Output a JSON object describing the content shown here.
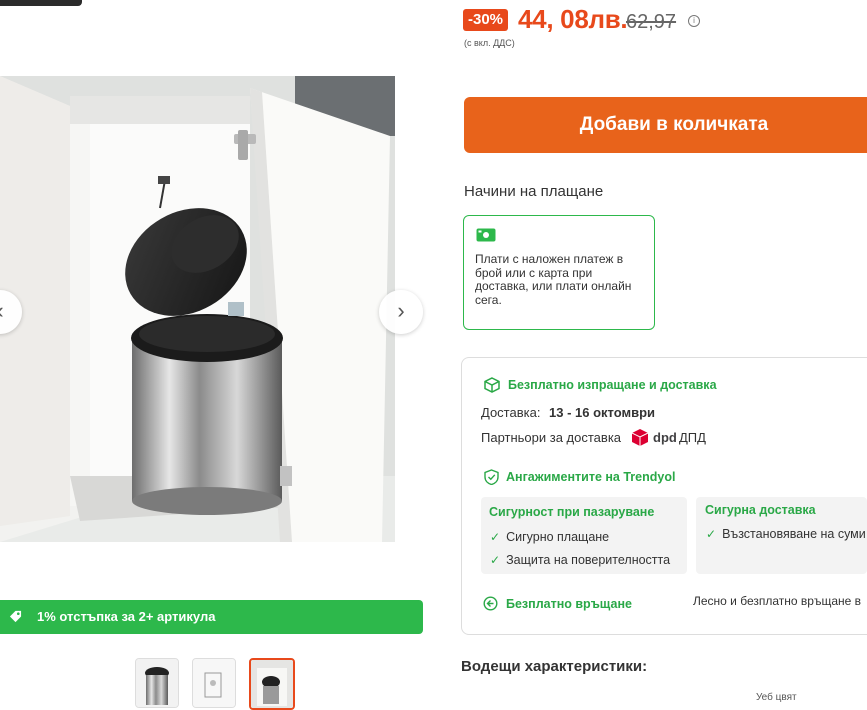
{
  "price": {
    "discount": "-30%",
    "current": "44, 08лв.",
    "old": "62,97",
    "info_icon": "info-icon",
    "vat_note": "(с вкл. ДДС)"
  },
  "gallery": {
    "prev_icon": "chevron-left-icon",
    "next_icon": "chevron-right-icon",
    "thumbnail_count": 3
  },
  "promo": {
    "icon": "tag-icon",
    "text": "1% отстъпка за 2+ артикула",
    "color": "#2db84b"
  },
  "cart": {
    "add_label": "Добави в количката",
    "color": "#e8631b"
  },
  "payment": {
    "heading": "Начини на плащане",
    "icon": "money-icon",
    "description": "Плати с наложен платеж в брой или с карта при доставка, или плати онлайн сега."
  },
  "delivery": {
    "icon": "box-icon",
    "free_shipping": "Безплатно изпращане и доставка",
    "label": "Доставка:",
    "dates": "13 - 16 октомври",
    "partners_label": "Партньори за доставка",
    "partner_name": "ДПД",
    "partner_logo_text": "dpd"
  },
  "commitments": {
    "icon": "shield-check-icon",
    "heading": "Ангажиментите на Trendyol",
    "secure_shopping": {
      "title": "Сигурност при пазаруване",
      "items": [
        "Сигурно плащане",
        "Защита на поверителността"
      ]
    },
    "secure_delivery": {
      "title": "Сигурна доставка",
      "items": [
        "Възстановяване на суми"
      ]
    }
  },
  "returns": {
    "icon": "return-icon",
    "title": "Безплатно връщане",
    "text": "Лесно и безплатно връщане в"
  },
  "features": {
    "heading": "Водещи характеристики:",
    "sliver": "Уеб цвят"
  },
  "colors": {
    "accent_orange": "#e8491b",
    "success_green": "#2aa847"
  }
}
